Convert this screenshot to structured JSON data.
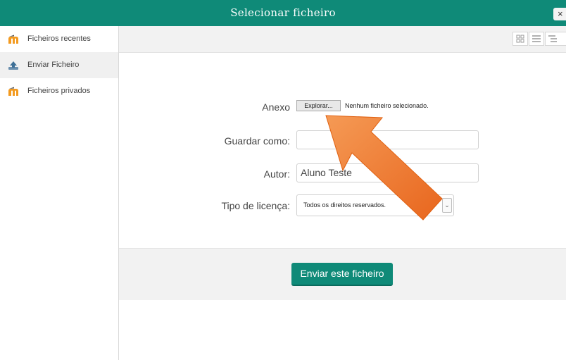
{
  "dialog": {
    "title": "Selecionar ficheiro",
    "close_label": "×"
  },
  "sidebar": {
    "items": [
      {
        "label": "Ficheiros recentes",
        "icon": "moodle-icon",
        "active": false
      },
      {
        "label": "Enviar Ficheiro",
        "icon": "upload-icon",
        "active": true
      },
      {
        "label": "Ficheiros privados",
        "icon": "moodle-icon",
        "active": false
      }
    ]
  },
  "toolbar": {
    "view_icons": [
      "grid-view-icon",
      "list-view-icon",
      "tree-view-icon"
    ]
  },
  "form": {
    "attachment_label": "Anexo",
    "browse_label": "Explorar...",
    "no_file_text": "Nenhum ficheiro selecionado.",
    "save_as_label": "Guardar como:",
    "save_as_value": "",
    "author_label": "Autor:",
    "author_value": "Aluno Teste",
    "license_label": "Tipo de licença:",
    "license_value": "Todos os direitos reservados."
  },
  "footer": {
    "submit_label": "Enviar este ficheiro"
  },
  "colors": {
    "accent": "#0f8a78",
    "arrow": "#f08030"
  }
}
